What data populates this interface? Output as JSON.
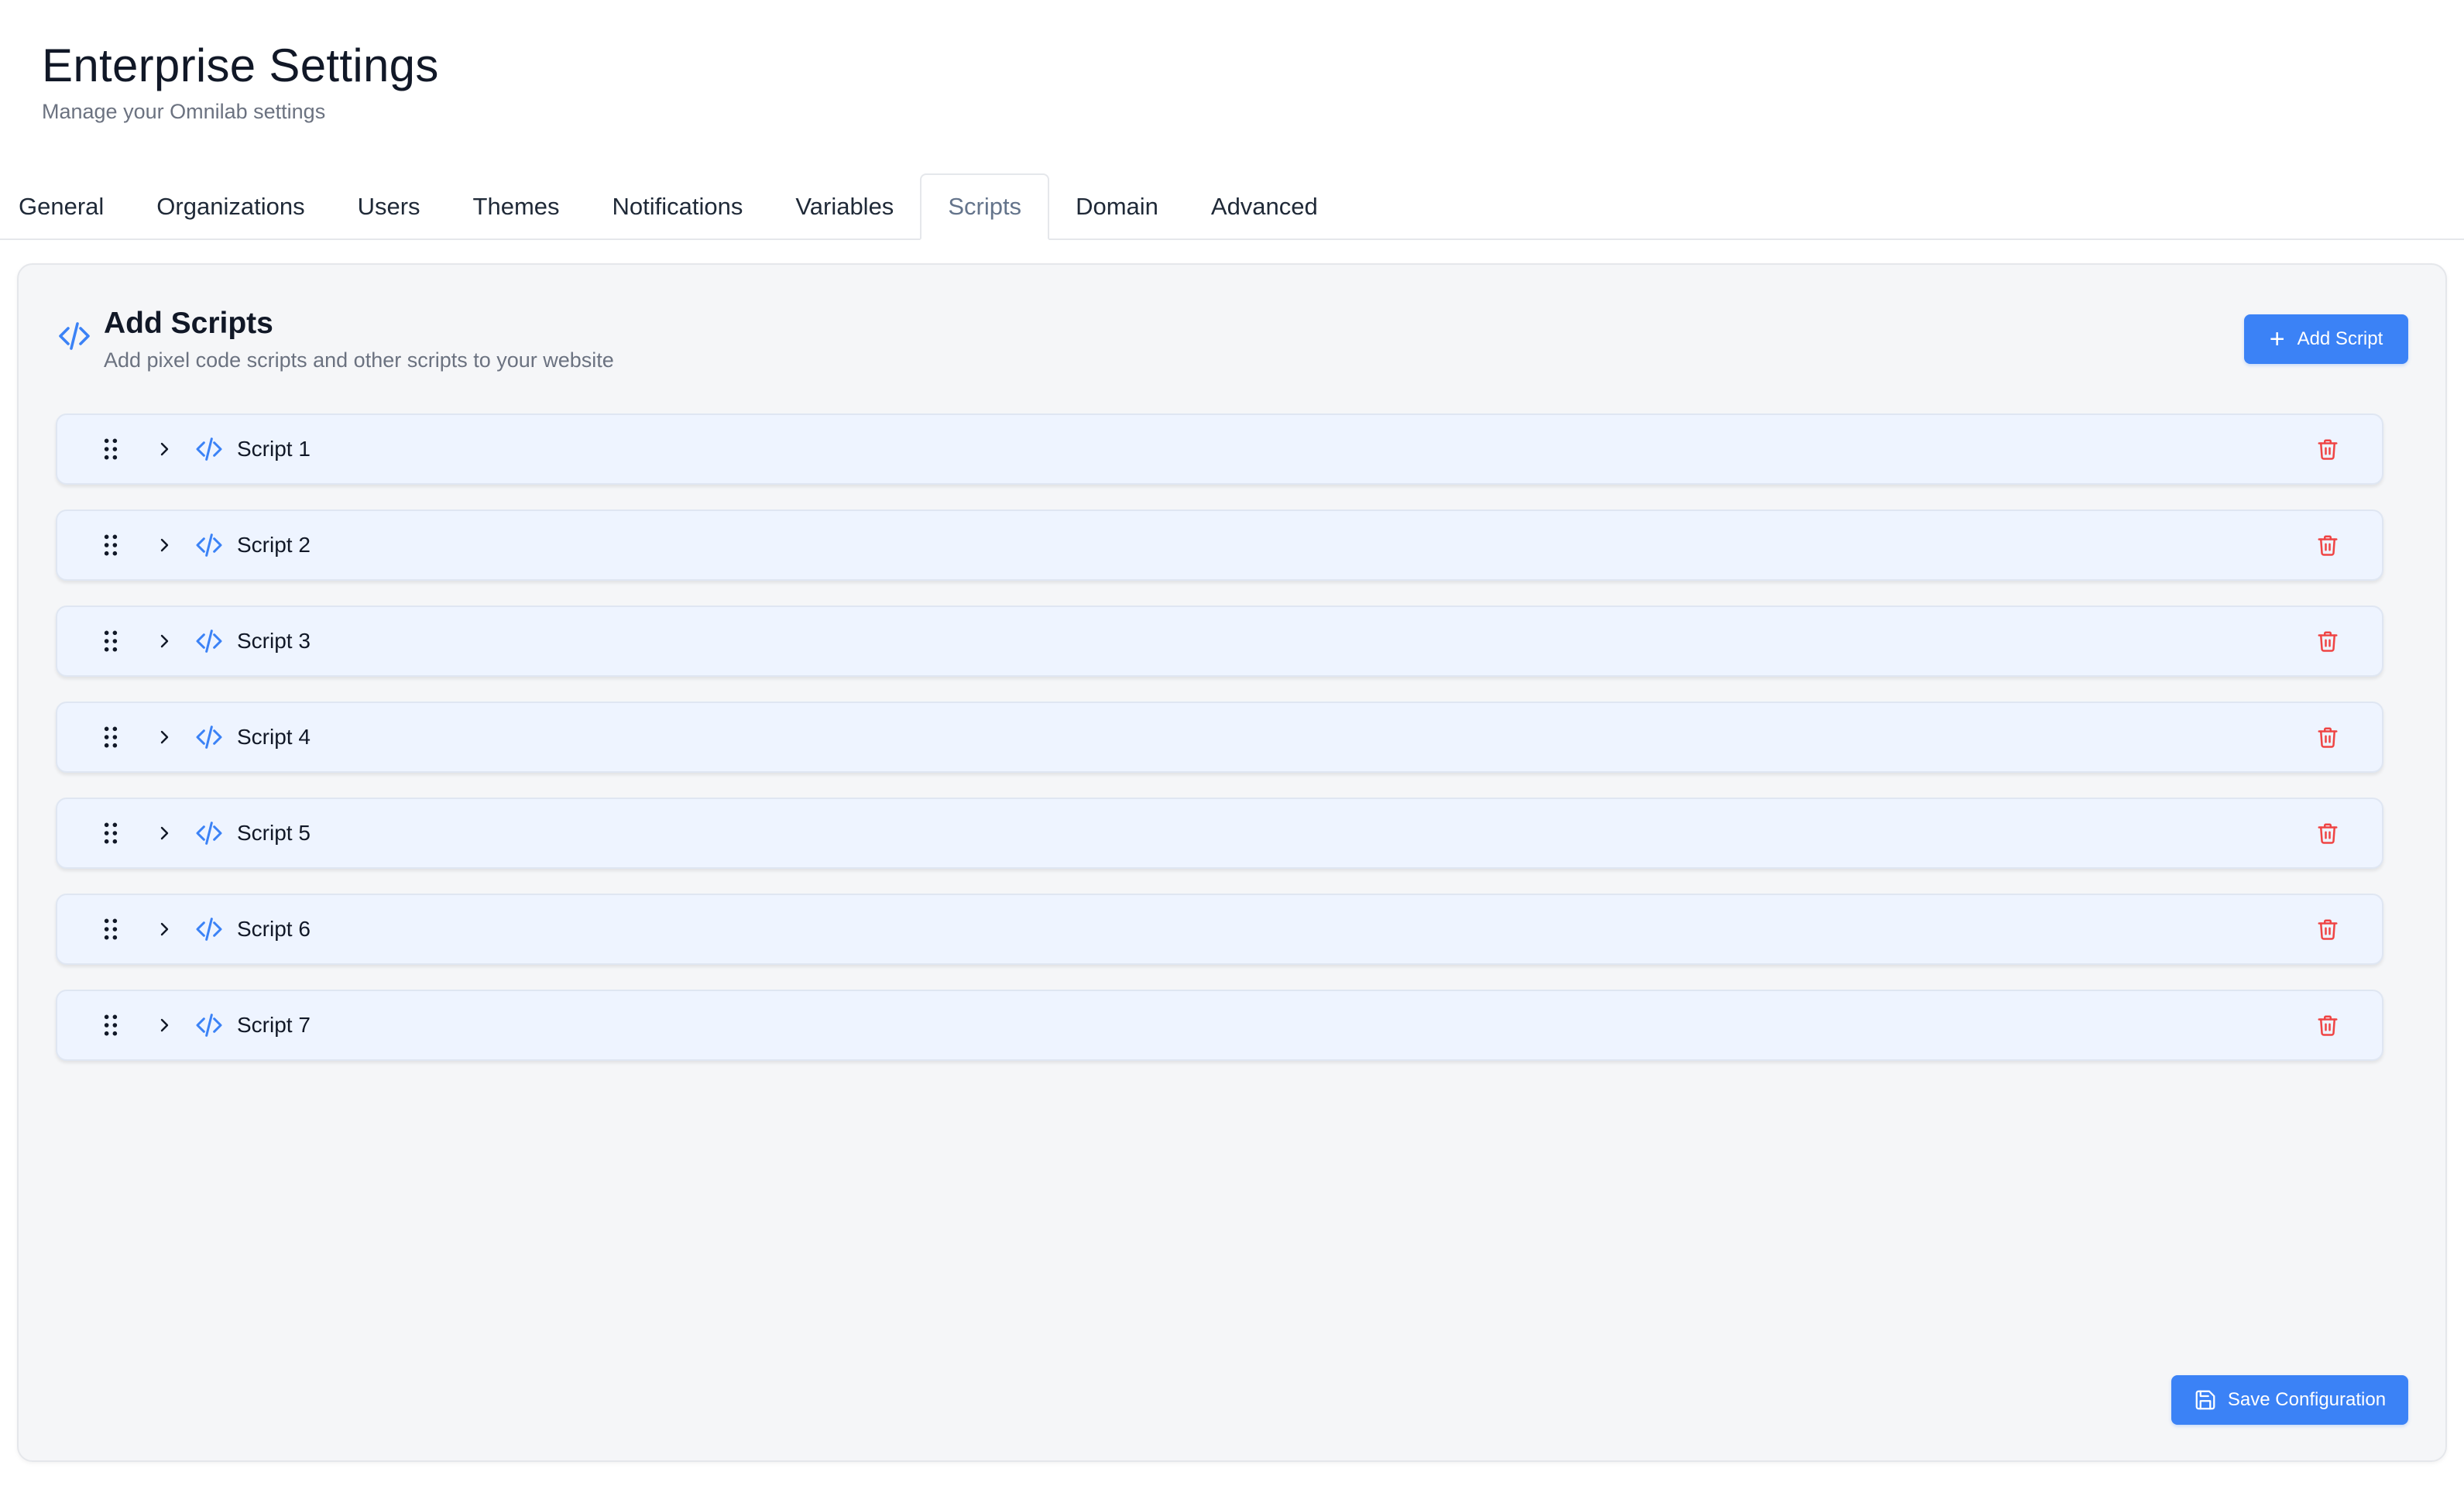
{
  "header": {
    "title": "Enterprise Settings",
    "subtitle": "Manage your Omnilab settings"
  },
  "tabs": [
    {
      "label": "General",
      "active": false
    },
    {
      "label": "Organizations",
      "active": false
    },
    {
      "label": "Users",
      "active": false
    },
    {
      "label": "Themes",
      "active": false
    },
    {
      "label": "Notifications",
      "active": false
    },
    {
      "label": "Variables",
      "active": false
    },
    {
      "label": "Scripts",
      "active": true
    },
    {
      "label": "Domain",
      "active": false
    },
    {
      "label": "Advanced",
      "active": false
    }
  ],
  "panel": {
    "icon": "code-icon",
    "title": "Add Scripts",
    "description": "Add pixel code scripts and other scripts to your website",
    "add_button_label": "Add Script",
    "save_button_label": "Save Configuration"
  },
  "scripts": [
    {
      "name": "Script 1"
    },
    {
      "name": "Script 2"
    },
    {
      "name": "Script 3"
    },
    {
      "name": "Script 4"
    },
    {
      "name": "Script 5"
    },
    {
      "name": "Script 6"
    },
    {
      "name": "Script 7"
    }
  ],
  "colors": {
    "accent": "#3b82f6",
    "danger": "#ef4444",
    "row_bg": "#eef4ff",
    "panel_bg": "#f5f6f8"
  }
}
